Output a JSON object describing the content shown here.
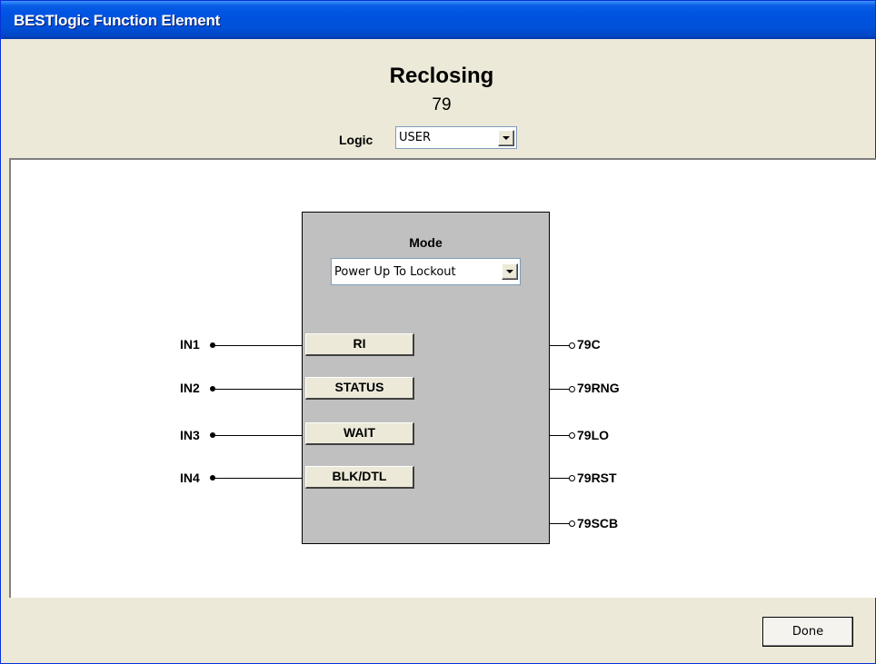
{
  "window": {
    "title": "BESTlogic Function Element"
  },
  "header": {
    "element_name": "Reclosing",
    "element_number": "79",
    "logic_label": "Logic",
    "logic_value": "USER"
  },
  "block": {
    "mode_label": "Mode",
    "mode_value": "Power Up To Lockout",
    "inputs": [
      {
        "pin": "IN1",
        "label": "RI"
      },
      {
        "pin": "IN2",
        "label": "STATUS"
      },
      {
        "pin": "IN3",
        "label": "WAIT"
      },
      {
        "pin": "IN4",
        "label": "BLK/DTL"
      }
    ],
    "outputs": [
      "79C",
      "79RNG",
      "79LO",
      "79RST",
      "79SCB"
    ]
  },
  "footer": {
    "done_label": "Done"
  }
}
